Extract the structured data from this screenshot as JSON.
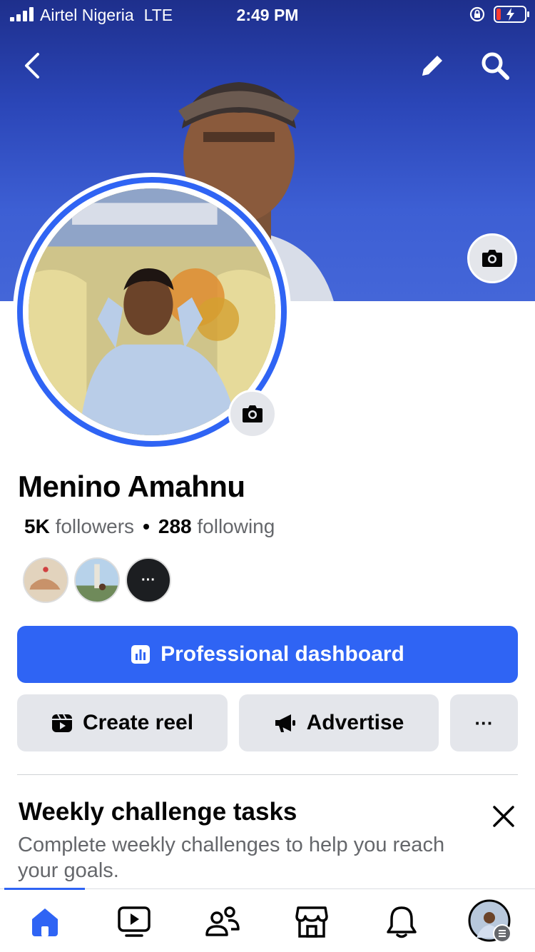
{
  "status_bar": {
    "carrier": "Airtel Nigeria",
    "network": "LTE",
    "time": "2:49 PM"
  },
  "header": {
    "icons": [
      "back-icon",
      "pencil-icon",
      "search-icon"
    ]
  },
  "profile": {
    "name": "Menino Amahnu",
    "followers_count": "5K",
    "followers_label": "followers",
    "following_count": "288",
    "following_label": "following",
    "separator": "•"
  },
  "featured_friends": {
    "more_label": "···"
  },
  "actions": {
    "professional_dashboard": "Professional dashboard",
    "create_reel": "Create reel",
    "advertise": "Advertise",
    "more": "···"
  },
  "weekly_challenge": {
    "title": "Weekly challenge tasks",
    "description": "Complete weekly challenges to help you reach your goals."
  },
  "tab_bar": {
    "tabs": [
      "home-icon",
      "video-icon",
      "friends-icon",
      "marketplace-icon",
      "bell-icon",
      "profile-avatar"
    ],
    "active": "home"
  },
  "colors": {
    "accent": "#2f64f4",
    "cover": "#3d5fd4",
    "secondary_text": "#65676b",
    "button_grey": "#e4e6eb"
  }
}
